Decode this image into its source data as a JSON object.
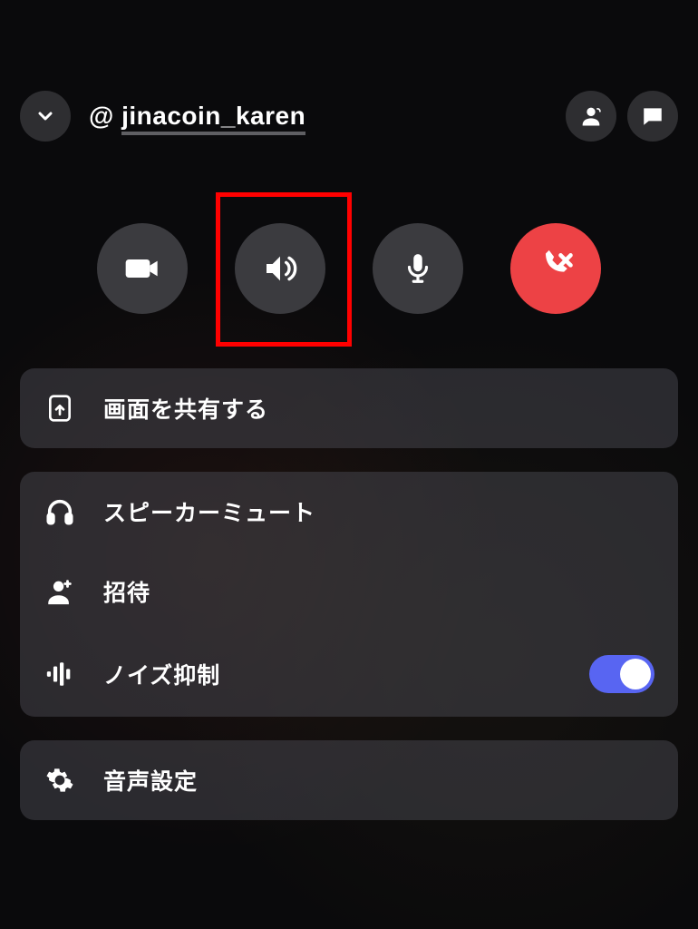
{
  "header": {
    "at": "@",
    "username": "jinacoin_karen"
  },
  "actions": {
    "share_screen": "画面を共有する",
    "speaker_mute": "スピーカーミュート",
    "invite": "招待",
    "noise_suppression": "ノイズ抑制",
    "voice_settings": "音声設定"
  },
  "noise_suppression_enabled": true
}
